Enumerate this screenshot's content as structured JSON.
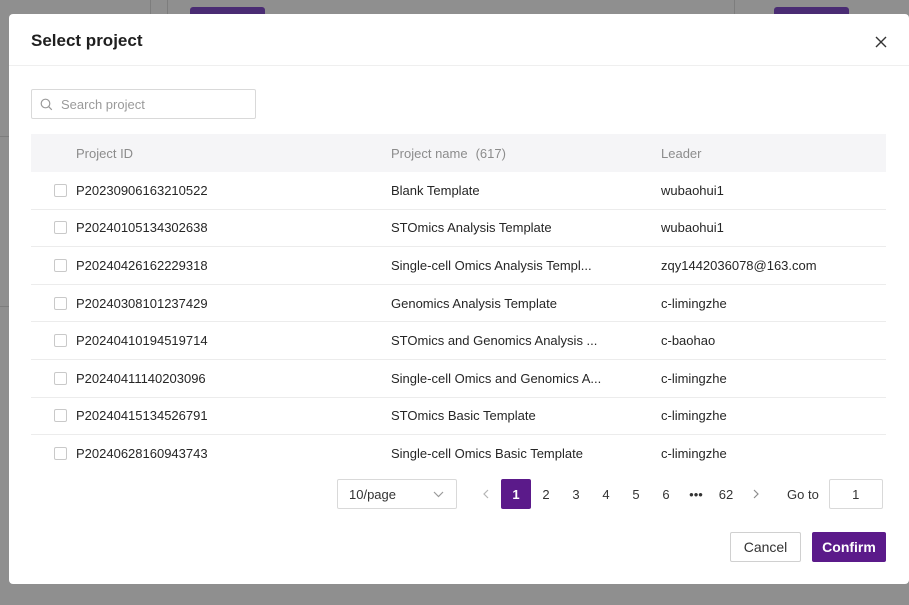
{
  "dialog": {
    "title": "Select project",
    "close_icon": "close-icon"
  },
  "search": {
    "placeholder": "Search project",
    "value": "",
    "icon": "search-icon"
  },
  "table": {
    "columns": {
      "id": "Project ID",
      "name": "Project name",
      "count": "(617)",
      "leader": "Leader"
    },
    "rows": [
      {
        "id": "P20230906163210522",
        "name": "Blank Template",
        "leader": "wubaohui1"
      },
      {
        "id": "P20240105134302638",
        "name": "STOmics Analysis Template",
        "leader": "wubaohui1"
      },
      {
        "id": "P20240426162229318",
        "name": "Single-cell Omics Analysis Templ...",
        "leader": "zqy1442036078@163.com"
      },
      {
        "id": "P20240308101237429",
        "name": "Genomics Analysis Template",
        "leader": "c-limingzhe"
      },
      {
        "id": "P20240410194519714",
        "name": "STOmics and Genomics Analysis ...",
        "leader": "c-baohao"
      },
      {
        "id": "P20240411140203096",
        "name": "Single-cell Omics and Genomics A...",
        "leader": "c-limingzhe"
      },
      {
        "id": "P20240415134526791",
        "name": "STOmics Basic Template",
        "leader": "c-limingzhe"
      },
      {
        "id": "P20240628160943743",
        "name": "Single-cell Omics Basic Template",
        "leader": "c-limingzhe"
      }
    ]
  },
  "pagination": {
    "page_size": "10/page",
    "pages": [
      "1",
      "2",
      "3",
      "4",
      "5",
      "6",
      "•••",
      "62"
    ],
    "current": "1",
    "prev_icon": "chevron-left-icon",
    "next_icon": "chevron-right-icon",
    "goto_label": "Go to",
    "goto_value": "1"
  },
  "footer": {
    "cancel_label": "Cancel",
    "confirm_label": "Confirm"
  },
  "colors": {
    "accent": "#5b1a8a",
    "mask": "#8b8b8b"
  }
}
